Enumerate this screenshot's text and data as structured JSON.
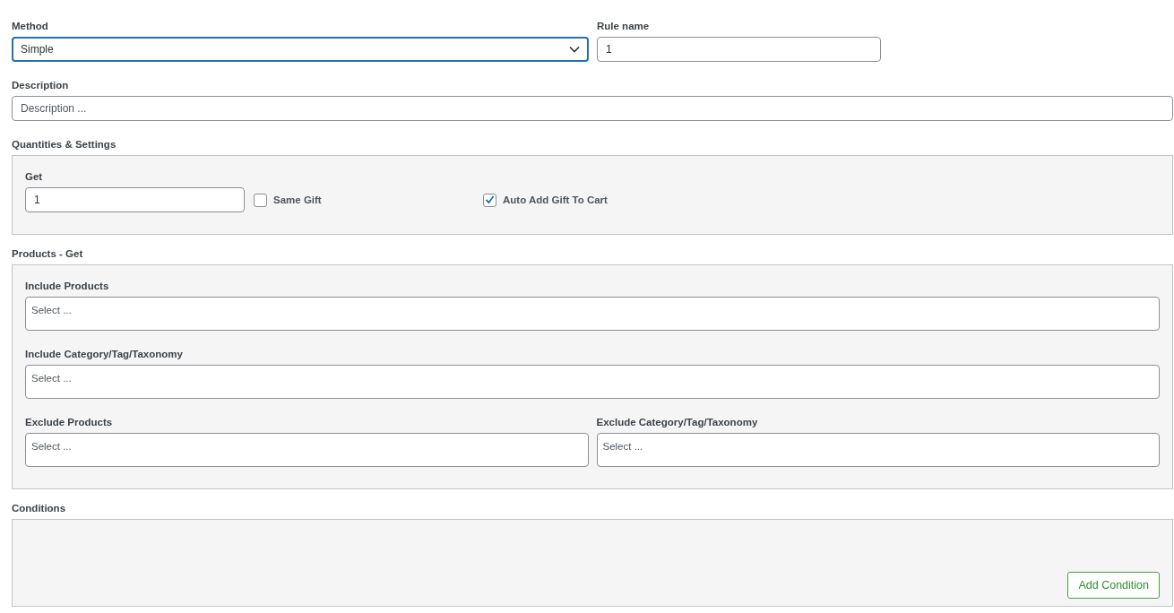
{
  "method": {
    "label": "Method",
    "value": "Simple"
  },
  "rule_name": {
    "label": "Rule name",
    "value": "1"
  },
  "description": {
    "label": "Description",
    "placeholder": "Description ..."
  },
  "quantities": {
    "title": "Quantities & Settings",
    "get": {
      "label": "Get",
      "value": "1"
    },
    "options": [
      {
        "label": "Same Gift",
        "checked": false
      },
      {
        "label": "Auto Add Gift To Cart",
        "checked": true
      }
    ]
  },
  "products_get": {
    "title": "Products - Get",
    "rows": [
      {
        "fields": [
          {
            "label": "Include Products",
            "placeholder": "Select ..."
          }
        ]
      },
      {
        "fields": [
          {
            "label": "Include Category/Tag/Taxonomy",
            "placeholder": "Select ..."
          }
        ]
      },
      {
        "fields": [
          {
            "label": "Exclude Products",
            "placeholder": "Select ..."
          },
          {
            "label": "Exclude Category/Tag/Taxonomy",
            "placeholder": "Select ..."
          }
        ]
      }
    ]
  },
  "conditions": {
    "title": "Conditions",
    "button": "Add Condition"
  }
}
